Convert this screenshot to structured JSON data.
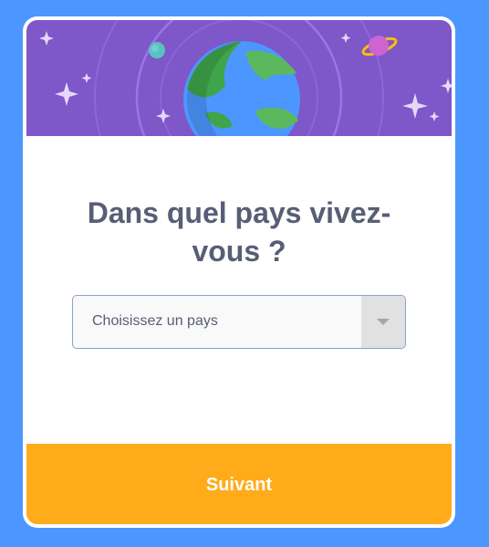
{
  "dialog": {
    "title": "Dans quel pays vivez-vous ?",
    "country_select": {
      "placeholder": "Choisissez un pays"
    },
    "next_button": "Suivant"
  },
  "icons": {
    "header_illustration": "earth-planets-stars-illustration",
    "dropdown_arrow": "caret-down-icon"
  },
  "colors": {
    "page_background": "#4C97FF",
    "header_background": "#7E57C9",
    "title_text": "#575E75",
    "next_button_background": "#FFAB1A",
    "next_button_text": "#FFFFFF"
  }
}
